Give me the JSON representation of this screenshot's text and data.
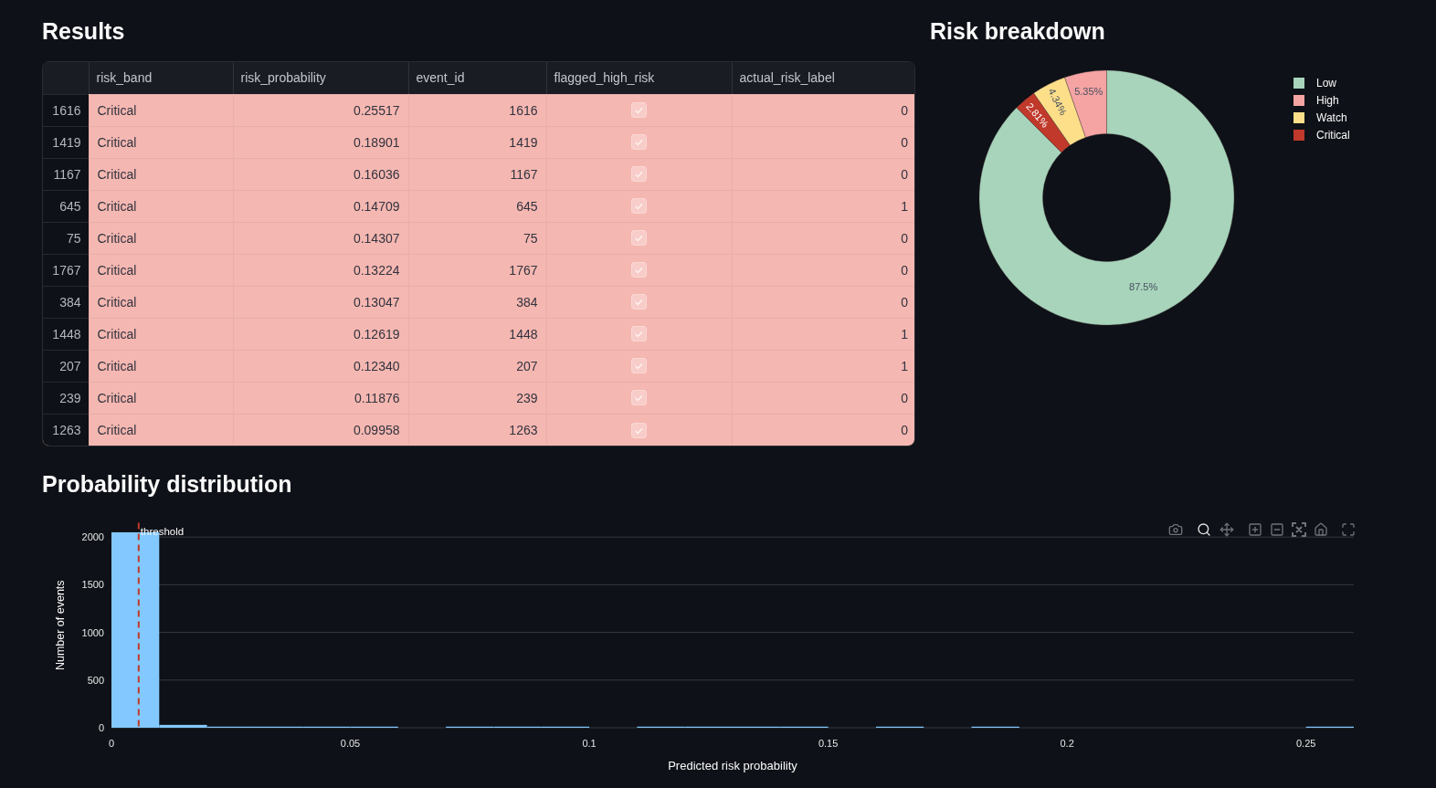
{
  "results": {
    "title": "Results",
    "table": {
      "columns": [
        "risk_band",
        "risk_probability",
        "event_id",
        "flagged_high_risk",
        "actual_risk_label"
      ],
      "rows": [
        {
          "index": "1616",
          "color": "#f5b7b1",
          "risk_band": "Critical",
          "risk_probability": "0.25517",
          "event_id": "1616",
          "flagged_high_risk": true,
          "actual_risk_label": "0"
        },
        {
          "index": "1419",
          "color": "#f5b7b1",
          "risk_band": "Critical",
          "risk_probability": "0.18901",
          "event_id": "1419",
          "flagged_high_risk": true,
          "actual_risk_label": "0"
        },
        {
          "index": "1167",
          "color": "#f5b7b1",
          "risk_band": "Critical",
          "risk_probability": "0.16036",
          "event_id": "1167",
          "flagged_high_risk": true,
          "actual_risk_label": "0"
        },
        {
          "index": "645",
          "color": "#f5b7b1",
          "risk_band": "Critical",
          "risk_probability": "0.14709",
          "event_id": "645",
          "flagged_high_risk": true,
          "actual_risk_label": "1"
        },
        {
          "index": "75",
          "color": "#f5b7b1",
          "risk_band": "Critical",
          "risk_probability": "0.14307",
          "event_id": "75",
          "flagged_high_risk": true,
          "actual_risk_label": "0"
        },
        {
          "index": "1767",
          "color": "#f5b7b1",
          "risk_band": "Critical",
          "risk_probability": "0.13224",
          "event_id": "1767",
          "flagged_high_risk": true,
          "actual_risk_label": "0"
        },
        {
          "index": "384",
          "color": "#f5b7b1",
          "risk_band": "Critical",
          "risk_probability": "0.13047",
          "event_id": "384",
          "flagged_high_risk": true,
          "actual_risk_label": "0"
        },
        {
          "index": "1448",
          "color": "#f5b7b1",
          "risk_band": "Critical",
          "risk_probability": "0.12619",
          "event_id": "1448",
          "flagged_high_risk": true,
          "actual_risk_label": "1"
        },
        {
          "index": "207",
          "color": "#f5b7b1",
          "risk_band": "Critical",
          "risk_probability": "0.12340",
          "event_id": "207",
          "flagged_high_risk": true,
          "actual_risk_label": "1"
        },
        {
          "index": "239",
          "color": "#f5b7b1",
          "risk_band": "Critical",
          "risk_probability": "0.11876",
          "event_id": "239",
          "flagged_high_risk": true,
          "actual_risk_label": "0"
        },
        {
          "index": "1263",
          "color": "#f5b7b1",
          "risk_band": "Critical",
          "risk_probability": "0.09958",
          "event_id": "1263",
          "flagged_high_risk": true,
          "actual_risk_label": "0"
        }
      ]
    }
  },
  "risk_breakdown": {
    "title": "Risk breakdown",
    "chart_data": {
      "type": "donut",
      "categories": [
        "Low",
        "High",
        "Watch",
        "Critical"
      ],
      "values": [
        87.5,
        5.35,
        4.34,
        2.81
      ],
      "value_labels": [
        "87.5%",
        "5.35%",
        "4.34%",
        "2.81%"
      ],
      "colors": [
        "#a7d4bb",
        "#f5a3a3",
        "#fddf8a",
        "#c0392b"
      ],
      "legend": true
    }
  },
  "distribution": {
    "title": "Probability distribution",
    "modebar": [
      {
        "kind": "camera",
        "selected": false
      },
      {
        "kind": "zoom",
        "selected": true
      },
      {
        "kind": "pan",
        "selected": false
      },
      {
        "kind": "zoom_in",
        "selected": false
      },
      {
        "kind": "zoom_out",
        "selected": false
      },
      {
        "kind": "autoscale",
        "selected": false
      },
      {
        "kind": "home",
        "selected": false
      },
      {
        "kind": "fullscreen",
        "selected": false
      }
    ],
    "chart_data": {
      "type": "bar",
      "xlabel": "Predicted risk probability",
      "ylabel": "Number of events",
      "x": [
        0.005,
        0.015,
        0.025,
        0.035,
        0.045,
        0.055,
        0.065,
        0.075,
        0.085,
        0.095,
        0.105,
        0.115,
        0.125,
        0.135,
        0.145,
        0.155,
        0.165,
        0.175,
        0.185,
        0.195,
        0.205,
        0.215,
        0.225,
        0.235,
        0.245,
        0.255
      ],
      "values": [
        2050,
        30,
        10,
        10,
        10,
        5,
        0,
        2,
        2,
        2,
        0,
        1,
        2,
        2,
        2,
        0,
        1,
        0,
        1,
        0,
        0,
        0,
        0,
        0,
        0,
        1
      ],
      "xlim": [
        0,
        0.26
      ],
      "ylim": [
        0,
        2150
      ],
      "xticks": [
        {
          "value": 0,
          "label": "0"
        },
        0.05,
        0.1,
        0.15,
        0.2,
        0.25
      ],
      "yticks": [
        {
          "value": 0,
          "label": "0"
        },
        500,
        1000,
        1500,
        2000
      ],
      "grid": true,
      "ref_lines": [
        {
          "axis": "x",
          "value": 0.0057,
          "label": "threshold"
        }
      ]
    }
  }
}
